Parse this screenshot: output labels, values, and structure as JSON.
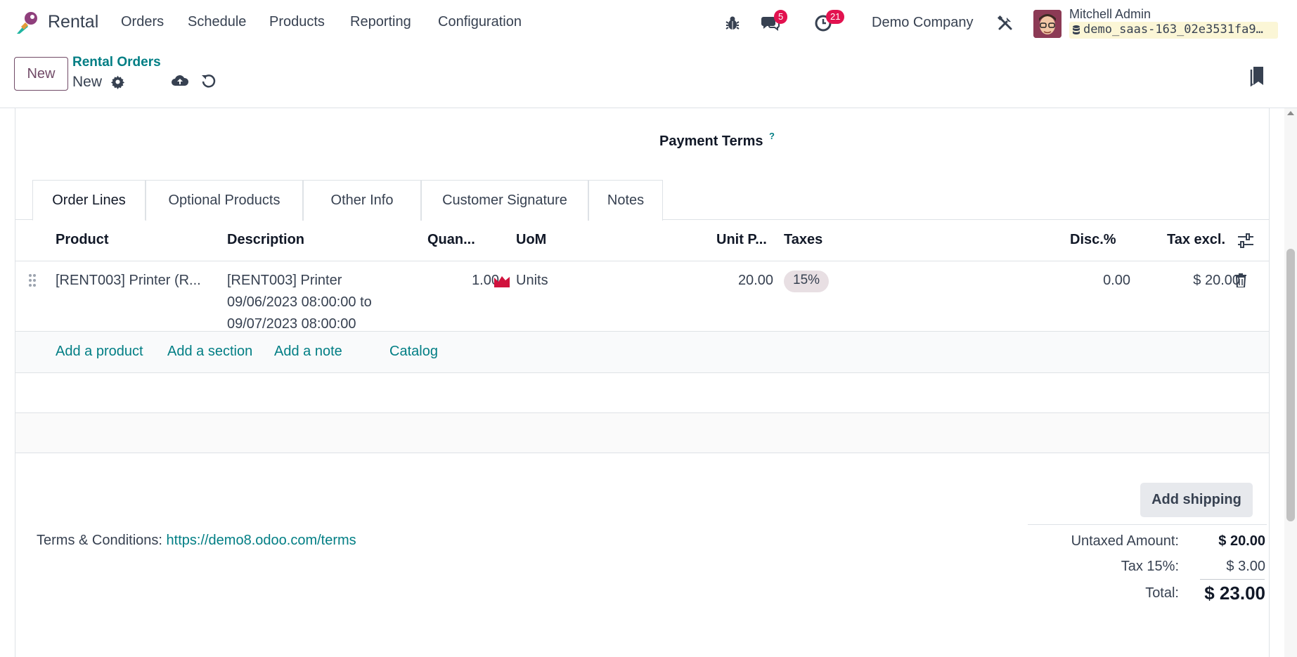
{
  "app": {
    "name": "Rental",
    "menu": [
      "Orders",
      "Schedule",
      "Products",
      "Reporting",
      "Configuration"
    ]
  },
  "systray": {
    "messages_count": "5",
    "activities_count": "21",
    "company": "Demo Company",
    "user_name": "Mitchell Admin",
    "database": "demo_saas-163_02e3531fa9…"
  },
  "control_panel": {
    "new_label": "New",
    "breadcrumb": "Rental Orders",
    "record_name": "New"
  },
  "form": {
    "payment_terms_label": "Payment Terms",
    "payment_terms_help": "?",
    "tabs": [
      "Order Lines",
      "Optional Products",
      "Other Info",
      "Customer Signature",
      "Notes"
    ],
    "columns": {
      "product": "Product",
      "description": "Description",
      "quantity": "Quan...",
      "uom": "UoM",
      "unit_price": "Unit P...",
      "taxes": "Taxes",
      "discount": "Disc.%",
      "subtotal": "Tax excl."
    },
    "line": {
      "product": "[RENT003] Printer (R...",
      "description_1": "[RENT003] Printer",
      "description_2": "09/06/2023 08:00:00 to",
      "description_3": "09/07/2023 08:00:00",
      "quantity": "1.00",
      "uom": "Units",
      "unit_price": "20.00",
      "tax": "15%",
      "discount": "0.00",
      "subtotal": "$ 20.00"
    },
    "add_links": {
      "product": "Add a product",
      "section": "Add a section",
      "note": "Add a note",
      "catalog": "Catalog"
    },
    "add_shipping": "Add shipping",
    "terms_label": "Terms & Conditions:",
    "terms_link": "https://demo8.odoo.com/terms",
    "totals": {
      "untaxed_label": "Untaxed Amount:",
      "untaxed_value": "$ 20.00",
      "tax_label": "Tax 15%:",
      "tax_value": "$ 3.00",
      "total_label": "Total:",
      "total_value": "$ 23.00"
    }
  },
  "colors": {
    "brand": "#714b67",
    "link": "#017e84",
    "badge": "#e2124f"
  }
}
